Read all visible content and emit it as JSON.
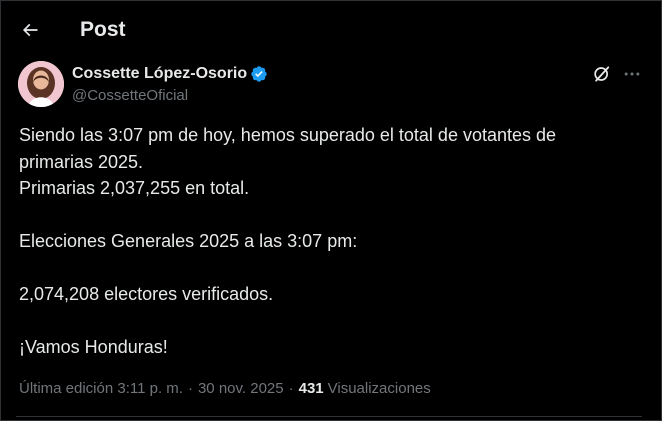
{
  "header": {
    "title": "Post",
    "back_icon": "arrow-left-icon"
  },
  "author": {
    "name": "Cossette López-Osorio",
    "handle": "@CossetteOficial",
    "verified_color": "#1d9bf0"
  },
  "actions": {
    "grok_icon": "grok-icon",
    "more_icon": "more-horizontal-icon"
  },
  "tweet": {
    "lines": [
      "Siendo las 3:07 pm de hoy, hemos superado el total de votantes de",
      "primarias 2025.",
      "Primarias 2,037,255 en total.",
      "",
      "Elecciones Generales 2025 a las 3:07 pm:",
      "",
      "2,074,208 electores verificados.",
      "",
      "¡Vamos Honduras!"
    ]
  },
  "meta": {
    "edited_label": "Última edición 3:11 p. m.",
    "separator": "·",
    "date": "30 nov. 2025",
    "views_count": "431",
    "views_label": "Visualizaciones"
  },
  "colors": {
    "background": "#000000",
    "text": "#e7e9ea",
    "secondary_text": "#71767b",
    "border": "#2f3336",
    "accent": "#1d9bf0"
  }
}
